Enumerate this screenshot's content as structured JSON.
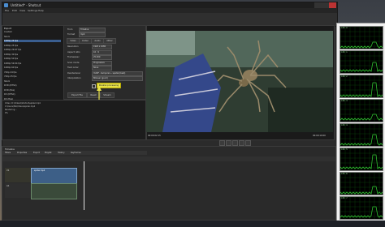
{
  "window": {
    "title": "Untitled* - Shotcut"
  },
  "menu": [
    "File",
    "Edit",
    "View",
    "Settings",
    "Help"
  ],
  "toolbar": [
    "Open File",
    "Open Other",
    "Save",
    "Undo",
    "Redo",
    "Peak Meter",
    "Properties",
    "Recent",
    "History",
    "Playlist",
    "Timeline",
    "Filters",
    "Keyframes",
    "Export"
  ],
  "left_panel": {
    "title": "Export",
    "items": [
      "Custom",
      "  Stock",
      "  1080p 24 fps",
      "  1080p 25 fps",
      "  1080p 29.97 fps",
      "  1080p 30 fps",
      "  1080p 50 fps",
      "  1080p 59.94 fps",
      "  1080p 60 fps",
      "  720p 24 fps",
      "  720p 25 fps",
      "Stock",
      "  DVD (NTSC)",
      "  DVD (PAL)",
      "  DV (NTSC)",
      "  DV (PAL)",
      "  HDV 720 25p",
      "  HDV 1080 25p",
      "  HDV 1080 30p",
      "  HDV 1080 50i",
      "  HDV 1080 60i",
      "  Lossless",
      "  Main"
    ],
    "selected": 2
  },
  "props": {
    "from_label": "From",
    "from_value": "Timeline",
    "format_label": "Format",
    "format_value": "mp4",
    "tabs": [
      "Video",
      "Codec",
      "Audio",
      "Other"
    ],
    "fields": [
      {
        "label": "Resolution",
        "value": "1920 x 1080"
      },
      {
        "label": "Aspect ratio",
        "value": "16 : 9"
      },
      {
        "label": "Frames/sec",
        "value": "25.000"
      },
      {
        "label": "Scan mode",
        "value": "Progressive"
      },
      {
        "label": "Field order",
        "value": "None"
      },
      {
        "label": "Deinterlacer",
        "value": "YADIF - temporal + spatial (best)"
      },
      {
        "label": "Interpolation",
        "value": "Bilinear (good)"
      }
    ],
    "parallel_label": "Parallel processing",
    "buttons": [
      "Export File",
      "Reset",
      "Stream"
    ]
  },
  "log": [
    "Video: D:\\Videos\\Shotcut\\spider.mp4",
    "   C:\\Users\\Me\\Videos\\spider.mp4",
    "Rendering...",
    "  0%"
  ],
  "viewer": {
    "timecode_left": "00:00:02:15",
    "timecode_right": "00:00:10:00",
    "tabs": [
      "Source",
      "Project"
    ]
  },
  "timeline_label": "Timeline",
  "timeline_tabs": [
    "Filters",
    "Properties",
    "Export",
    "Playlist",
    "History",
    "Keyframes"
  ],
  "track_names": [
    "V1",
    "A1"
  ],
  "clip_label": "spider.mp4",
  "monitor": {
    "cpus": [
      "CPU 0",
      "CPU 1",
      "CPU 2",
      "CPU 3",
      "CPU 4",
      "CPU 5",
      "CPU 6",
      "CPU 7"
    ]
  },
  "colors": {
    "accent": "#3a5e8f",
    "highlight": "#e8e24a",
    "graph": "#2fbf2f"
  }
}
